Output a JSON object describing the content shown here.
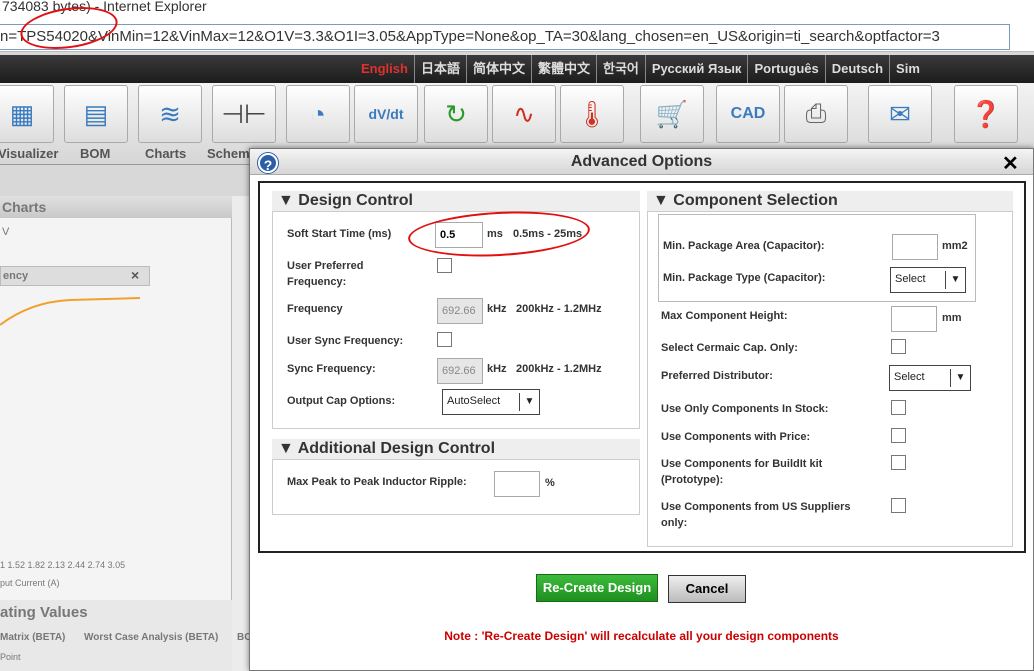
{
  "browser": {
    "title": "734083 bytes) - Internet Explorer",
    "url": "n=TPS54020&VinMin=12&VinMax=12&O1V=3.3&O1I=3.05&AppType=None&op_TA=30&lang_chosen=en_US&origin=ti_search&optfactor=3"
  },
  "languages": [
    "English",
    "日本語",
    "简体中文",
    "繁體中文",
    "한국어",
    "Русский Язык",
    "Português",
    "Deutsch",
    "Sim"
  ],
  "toolbar": {
    "labels": [
      "Visualizer",
      "BOM",
      "Charts",
      "Schem"
    ]
  },
  "background": {
    "charts_title": "Charts",
    "charts_sub": "V",
    "efficiency_tab": "ency",
    "efficiency_close": "×",
    "axis_ticks": "1 1.52 1.82 2.13 2.44 2.74 3.05",
    "axis_label": "put Current (A)",
    "operating_title": "ating Values",
    "tab1": "Matrix (BETA)",
    "tab2": "Worst Case Analysis (BETA)",
    "tab3": "BO",
    "point_label": "Point"
  },
  "modal": {
    "title": "Advanced Options",
    "design_control": {
      "header": "Design Control",
      "soft_start_label": "Soft Start Time (ms)",
      "soft_start_value": "0.5",
      "soft_start_unit": "ms",
      "soft_start_range": "0.5ms - 25ms",
      "user_pref_freq_label": "User Preferred Frequency:",
      "frequency_label": "Frequency",
      "frequency_value": "692.66",
      "frequency_unit": "kHz",
      "frequency_range": "200kHz - 1.2MHz",
      "user_sync_label": "User Sync Frequency:",
      "sync_label": "Sync Frequency:",
      "sync_value": "692.66",
      "sync_unit": "kHz",
      "sync_range": "200kHz - 1.2MHz",
      "output_cap_label": "Output Cap Options:",
      "output_cap_value": "AutoSelect"
    },
    "additional": {
      "header": "Additional Design Control",
      "ripple_label": "Max Peak to Peak Inductor Ripple:",
      "ripple_value": "",
      "ripple_unit": "%"
    },
    "component": {
      "header": "Component Selection",
      "min_area_label": "Min. Package Area (Capacitor):",
      "min_area_unit": "mm2",
      "min_type_label": "Min. Package Type (Capacitor):",
      "min_type_value": "Select",
      "max_height_label": "Max Component Height:",
      "max_height_unit": "mm",
      "ceramic_label": "Select Cermaic Cap. Only:",
      "distributor_label": "Preferred Distributor:",
      "distributor_value": "Select",
      "in_stock_label": "Use Only Components In Stock:",
      "with_price_label": "Use Components with Price:",
      "buildit_label": "Use Components for BuildIt kit (Prototype):",
      "us_suppliers_label": "Use Components from US Suppliers only:"
    },
    "recreate_label": "Re-Create Design",
    "cancel_label": "Cancel",
    "note": "Note : 'Re-Create Design' will recalculate all your design components"
  }
}
